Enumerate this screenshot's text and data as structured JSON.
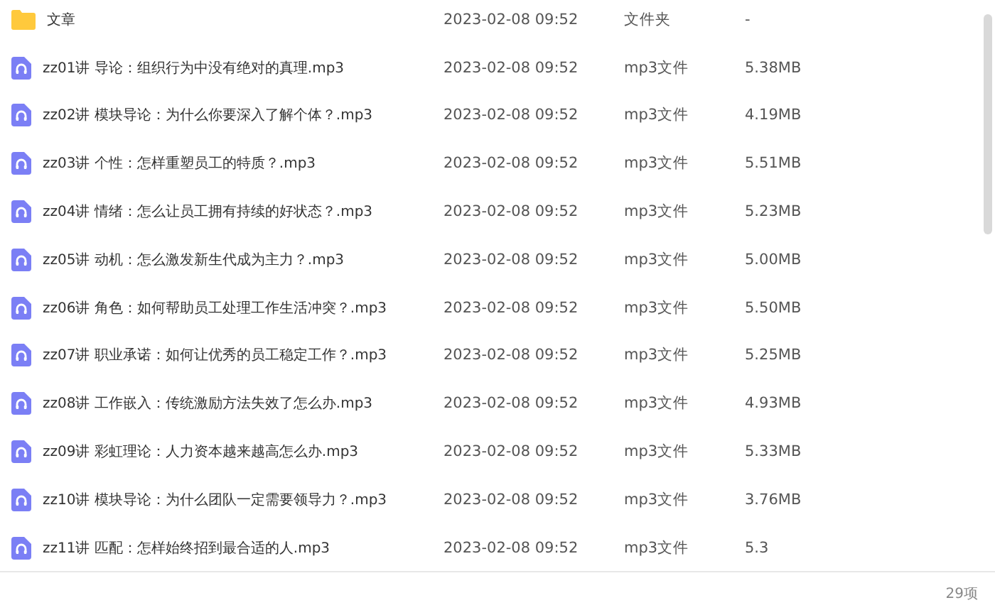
{
  "files": [
    {
      "kind": "folder",
      "name": "文章",
      "modified": "2023-02-08 09:52",
      "type": "文件夹",
      "size": "-"
    },
    {
      "kind": "audio",
      "name": "zz01讲  导论：组织行为中没有绝对的真理.mp3",
      "modified": "2023-02-08 09:52",
      "type": "mp3文件",
      "size": "5.38MB"
    },
    {
      "kind": "audio",
      "name": "zz02讲  模块导论：为什么你要深入了解个体？.mp3",
      "modified": "2023-02-08 09:52",
      "type": "mp3文件",
      "size": "4.19MB"
    },
    {
      "kind": "audio",
      "name": "zz03讲  个性：怎样重塑员工的特质？.mp3",
      "modified": "2023-02-08 09:52",
      "type": "mp3文件",
      "size": "5.51MB"
    },
    {
      "kind": "audio",
      "name": "zz04讲  情绪：怎么让员工拥有持续的好状态？.mp3",
      "modified": "2023-02-08 09:52",
      "type": "mp3文件",
      "size": "5.23MB"
    },
    {
      "kind": "audio",
      "name": "zz05讲  动机：怎么激发新生代成为主力？.mp3",
      "modified": "2023-02-08 09:52",
      "type": "mp3文件",
      "size": "5.00MB"
    },
    {
      "kind": "audio",
      "name": "zz06讲  角色：如何帮助员工处理工作生活冲突？.mp3",
      "modified": "2023-02-08 09:52",
      "type": "mp3文件",
      "size": "5.50MB"
    },
    {
      "kind": "audio",
      "name": "zz07讲  职业承诺：如何让优秀的员工稳定工作？.mp3",
      "modified": "2023-02-08 09:52",
      "type": "mp3文件",
      "size": "5.25MB"
    },
    {
      "kind": "audio",
      "name": "zz08讲  工作嵌入：传统激励方法失效了怎么办.mp3",
      "modified": "2023-02-08 09:52",
      "type": "mp3文件",
      "size": "4.93MB"
    },
    {
      "kind": "audio",
      "name": "zz09讲  彩虹理论：人力资本越来越高怎么办.mp3",
      "modified": "2023-02-08 09:52",
      "type": "mp3文件",
      "size": "5.33MB"
    },
    {
      "kind": "audio",
      "name": "zz10讲  模块导论：为什么团队一定需要领导力？.mp3",
      "modified": "2023-02-08 09:52",
      "type": "mp3文件",
      "size": "3.76MB"
    },
    {
      "kind": "audio",
      "name": "zz11讲  匹配：怎样始终招到最合适的人.mp3",
      "modified": "2023-02-08 09:52",
      "type": "mp3文件",
      "size": "5.3"
    }
  ],
  "status_bar": {
    "count": "29项"
  }
}
